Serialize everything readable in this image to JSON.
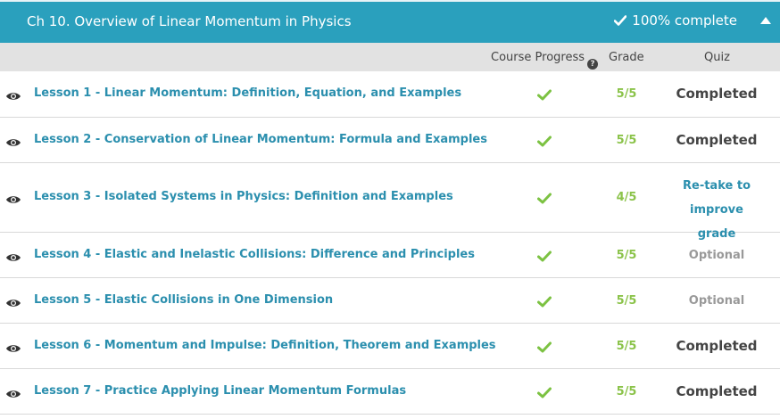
{
  "chapter": {
    "title": "Ch 10. Overview of Linear Momentum in Physics",
    "status": "100% complete",
    "accent_color": "#2aa0bd",
    "collapse_icon": "caret-up-icon"
  },
  "columns": {
    "progress": "Course Progress",
    "grade": "Grade",
    "quiz": "Quiz"
  },
  "lessons": [
    {
      "title": "Lesson 1 - Linear Momentum: Definition, Equation, and Examples",
      "progress_icon": "check-icon",
      "grade": "5/5",
      "quiz": "Completed"
    },
    {
      "title": "Lesson 2 - Conservation of Linear Momentum: Formula and Examples",
      "progress_icon": "check-icon",
      "grade": "5/5",
      "quiz": "Completed"
    },
    {
      "title": "Lesson 3 - Isolated Systems in Physics: Definition and Examples",
      "progress_icon": "check-icon",
      "grade": "4/5",
      "quiz_line1": "Re-take to improve",
      "quiz_line2": "grade"
    },
    {
      "title": "Lesson 4 - Elastic and Inelastic Collisions: Difference and Principles",
      "progress_icon": "check-icon",
      "grade": "5/5",
      "quiz": "Optional"
    },
    {
      "title": "Lesson 5 - Elastic Collisions in One Dimension",
      "progress_icon": "check-icon",
      "grade": "5/5",
      "quiz": "Optional"
    },
    {
      "title": "Lesson 6 - Momentum and Impulse: Definition, Theorem and Examples",
      "progress_icon": "check-icon",
      "grade": "5/5",
      "quiz": "Completed"
    },
    {
      "title": "Lesson 7 - Practice Applying Linear Momentum Formulas",
      "progress_icon": "check-icon",
      "grade": "5/5",
      "quiz": "Completed"
    }
  ]
}
